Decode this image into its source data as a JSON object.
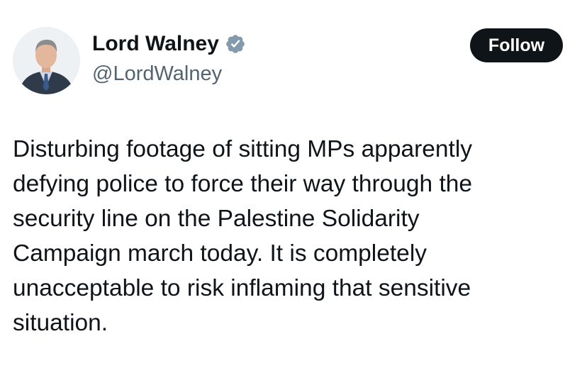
{
  "author": {
    "display_name": "Lord Walney",
    "handle": "@LordWalney",
    "verified_icon": "verified-badge-icon",
    "avatar_icon": "profile-photo"
  },
  "follow_button": {
    "label": "Follow"
  },
  "tweet": {
    "lines": [
      "Disturbing footage of sitting MPs apparently",
      "defying police to force their way through the",
      "security line on the Palestine Solidarity",
      "Campaign march today. It is completely",
      "unacceptable to risk inflaming that sensitive",
      "situation."
    ]
  },
  "colors": {
    "text": "#0f1419",
    "secondary_text": "#536471",
    "verified": "#829aab",
    "button_bg": "#0f1419",
    "button_text": "#ffffff"
  }
}
